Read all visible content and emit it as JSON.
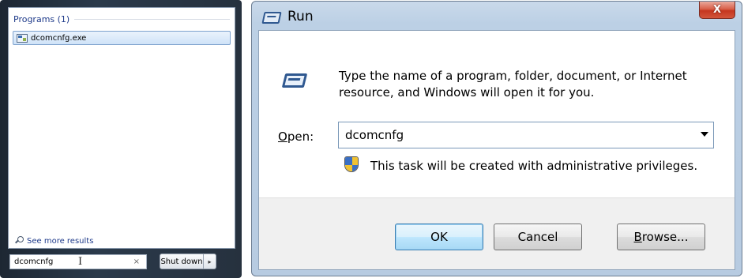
{
  "start_menu": {
    "programs_header": "Programs (1)",
    "program_items": [
      {
        "label": "dcomcnfg.exe"
      }
    ],
    "see_more_label": "See more results",
    "search_value": "dcomcnfg",
    "clear_glyph": "×",
    "shutdown_label": "Shut down",
    "shutdown_arrow": "▸"
  },
  "run_dialog": {
    "title": "Run",
    "close_glyph": "X",
    "description": "Type the name of a program, folder, document, or Internet resource, and Windows will open it for you.",
    "open_label_accel": "O",
    "open_label_rest": "pen:",
    "open_value": "dcomcnfg",
    "admin_note": "This task will be created with administrative privileges.",
    "buttons": {
      "ok": "OK",
      "cancel": "Cancel",
      "browse_accel": "B",
      "browse_rest": "rowse..."
    }
  },
  "colors": {
    "title_close_red": "#c5361f",
    "link_blue": "#1e3a8a",
    "shield_blue": "#3a6fc4",
    "shield_yellow": "#f1c232"
  }
}
